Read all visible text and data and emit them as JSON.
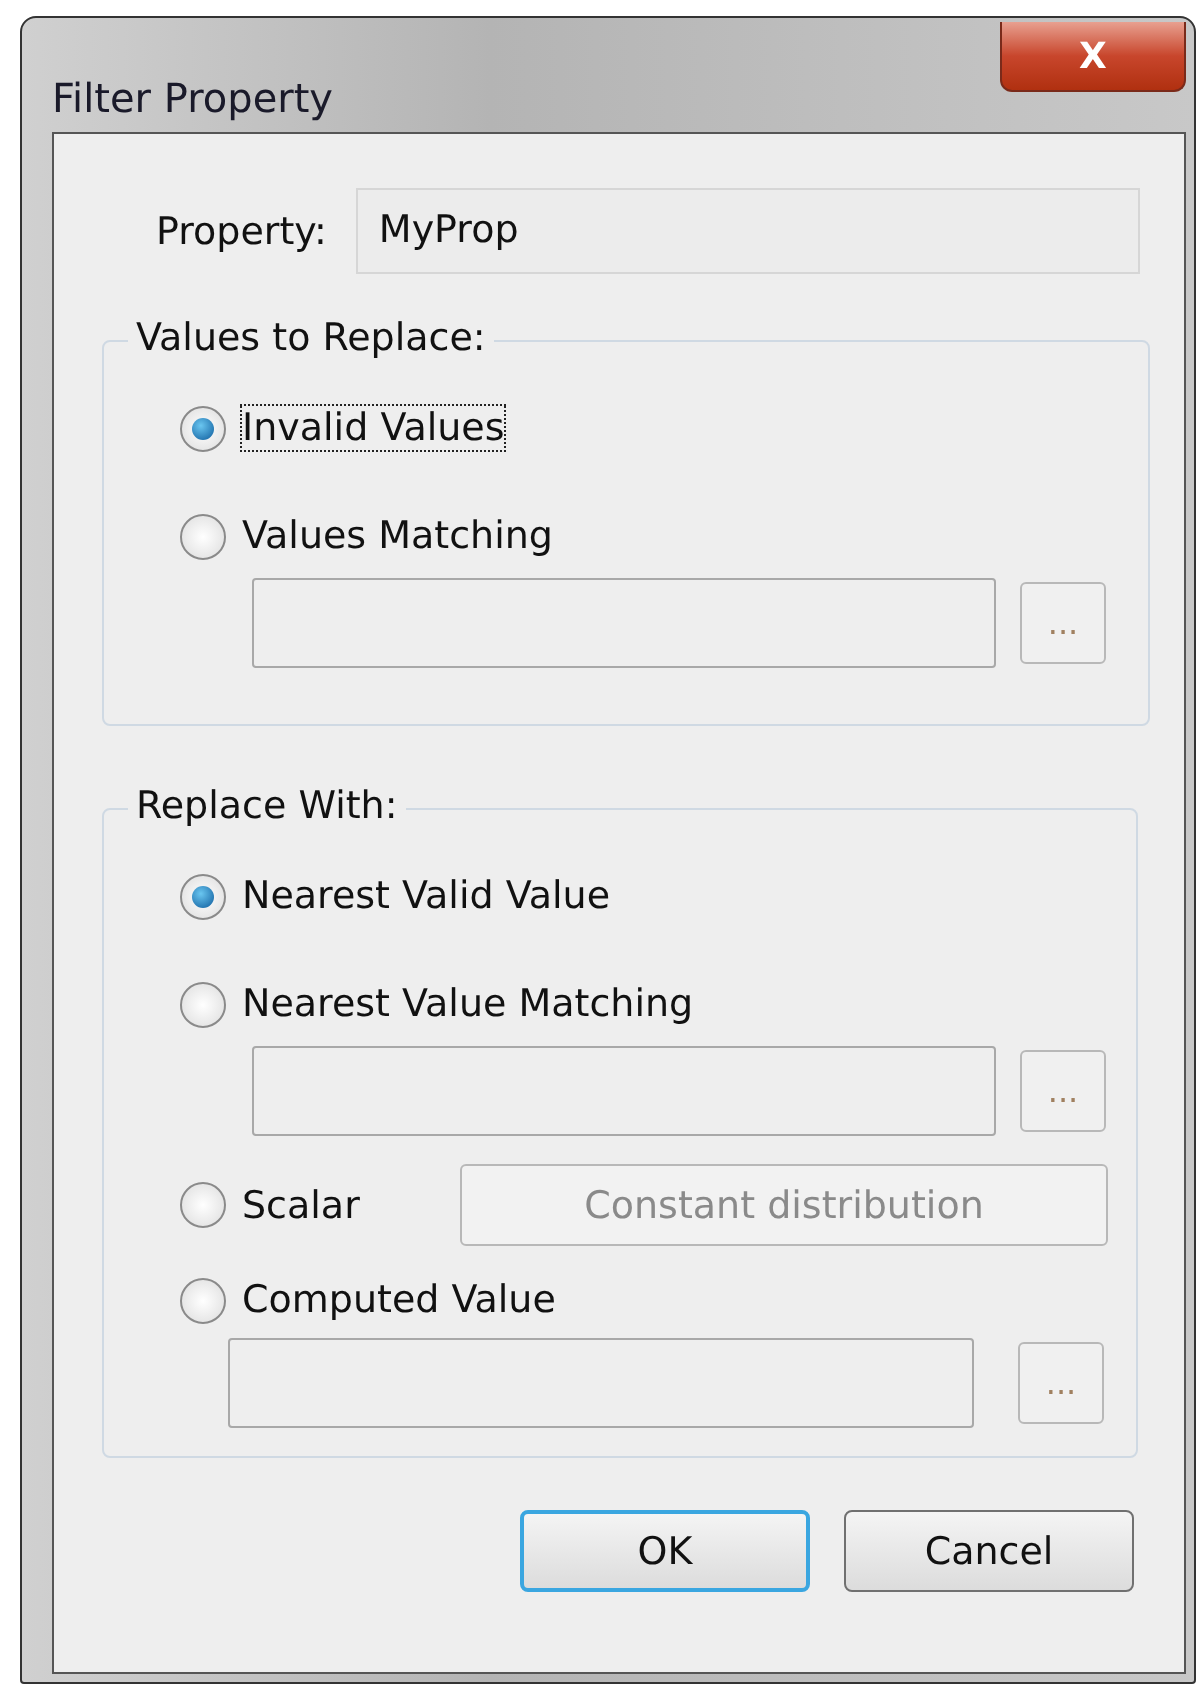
{
  "window": {
    "title": "Filter Property",
    "close_label": "X"
  },
  "property": {
    "label": "Property:",
    "value": "MyProp"
  },
  "groups": [
    {
      "title": "Values to Replace:",
      "options": [
        {
          "kind": "radio",
          "label": "Invalid Values",
          "selected": true,
          "focused": true
        },
        {
          "kind": "radio_field",
          "label": "Values Matching",
          "selected": false,
          "focused": false,
          "browse_label": "..."
        }
      ]
    },
    {
      "title": "Replace With:",
      "options": [
        {
          "kind": "radio",
          "label": "Nearest Valid Value",
          "selected": true,
          "focused": false
        },
        {
          "kind": "radio_field",
          "label": "Nearest Value Matching",
          "selected": false,
          "focused": false,
          "browse_label": "..."
        },
        {
          "kind": "radio_button",
          "label": "Scalar",
          "selected": false,
          "focused": false,
          "button": {
            "label": "Constant distribution",
            "disabled": true
          }
        },
        {
          "kind": "radio_field_wide",
          "label": "Computed Value",
          "selected": false,
          "focused": false,
          "browse_label": "..."
        }
      ]
    }
  ],
  "buttons": [
    {
      "label": "OK",
      "default": true
    },
    {
      "label": "Cancel",
      "default": false
    }
  ]
}
